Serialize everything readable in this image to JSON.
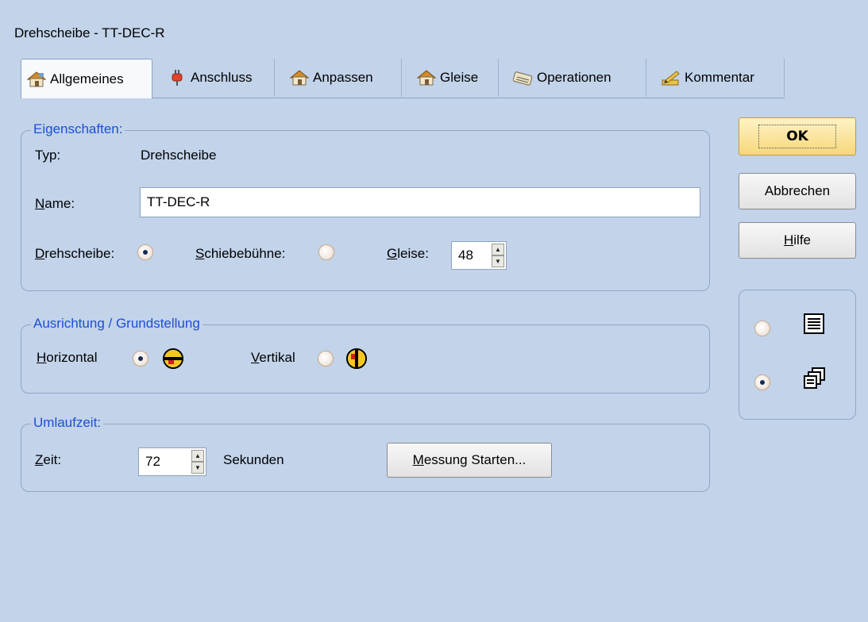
{
  "window": {
    "title": "Drehscheibe - TT-DEC-R"
  },
  "tabs": [
    {
      "label": "Allgemeines",
      "icon": "house-icon",
      "active": true
    },
    {
      "label": "Anschluss",
      "icon": "plug-icon",
      "active": false
    },
    {
      "label": "Anpassen",
      "icon": "house-icon",
      "active": false
    },
    {
      "label": "Gleise",
      "icon": "house-icon",
      "active": false
    },
    {
      "label": "Operationen",
      "icon": "keyboard-icon",
      "active": false
    },
    {
      "label": "Kommentar",
      "icon": "pencil-icon",
      "active": false
    }
  ],
  "eigenschaften": {
    "legend": "Eigenschaften:",
    "typ_label": "Typ:",
    "typ_value": "Drehscheibe",
    "name_label_first": "N",
    "name_label_rest": "ame:",
    "name_value": "TT-DEC-R",
    "drehscheibe_label_first": "D",
    "drehscheibe_label_rest": "rehscheibe:",
    "drehscheibe_checked": true,
    "schiebebuehne_label_first": "S",
    "schiebebuehne_label_rest": "chiebebühne:",
    "schiebebuehne_checked": false,
    "gleise_label_first": "G",
    "gleise_label_rest": "leise:",
    "gleise_value": "48"
  },
  "ausrichtung": {
    "legend": "Ausrichtung / Grundstellung",
    "horizontal_label_first": "H",
    "horizontal_label_rest": "orizontal",
    "horizontal_checked": true,
    "vertikal_label_first": "V",
    "vertikal_label_rest": "ertikal",
    "vertikal_checked": false
  },
  "umlaufzeit": {
    "legend": "Umlaufzeit:",
    "zeit_label_first": "Z",
    "zeit_label_rest": "eit:",
    "zeit_value": "72",
    "unit": "Sekunden",
    "messung_button_first": "M",
    "messung_button_rest": "essung Starten..."
  },
  "buttons": {
    "ok": "OK",
    "cancel": "Abbrechen",
    "help_first": "H",
    "help_rest": "ilfe"
  },
  "view_mode": {
    "list_checked": false,
    "cascade_checked": true
  },
  "colors": {
    "accent": "#1c4fd4",
    "background": "#c2d3ea",
    "ok_button": "#f6d77a"
  }
}
